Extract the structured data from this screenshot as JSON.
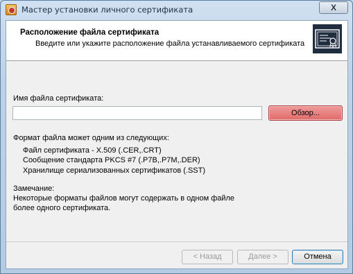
{
  "window": {
    "title": "Мастер установки личного сертификата",
    "close_glyph": "X"
  },
  "header": {
    "title": "Расположение файла сертификата",
    "subtitle": "Введите или укажите расположение файла устанавливаемого сертификата"
  },
  "form": {
    "file_label": "Имя файла сертификата:",
    "file_value": "",
    "browse_label": "Обзор...",
    "formats_intro": "Формат файла может одним из следующих:",
    "formats": [
      "Файл сертификата - X.509 (.CER,.CRT)",
      "Сообщение стандарта PKCS #7 (.P7B,.P7M,.DER)",
      "Хранилище сериализованных сертификатов (.SST)"
    ],
    "note_title": "Замечание:",
    "note_lines": [
      "Некоторые форматы файлов могут содержать в одном файле",
      "более одного сертификата."
    ]
  },
  "buttons": {
    "back": "< Назад",
    "next": "Далее >",
    "cancel": "Отмена"
  },
  "colors": {
    "browse_highlight": "#e06a6a",
    "header_bg": "#ffffff"
  },
  "icons": {
    "app": "certificate-app-icon",
    "header": "certificate-icon"
  }
}
